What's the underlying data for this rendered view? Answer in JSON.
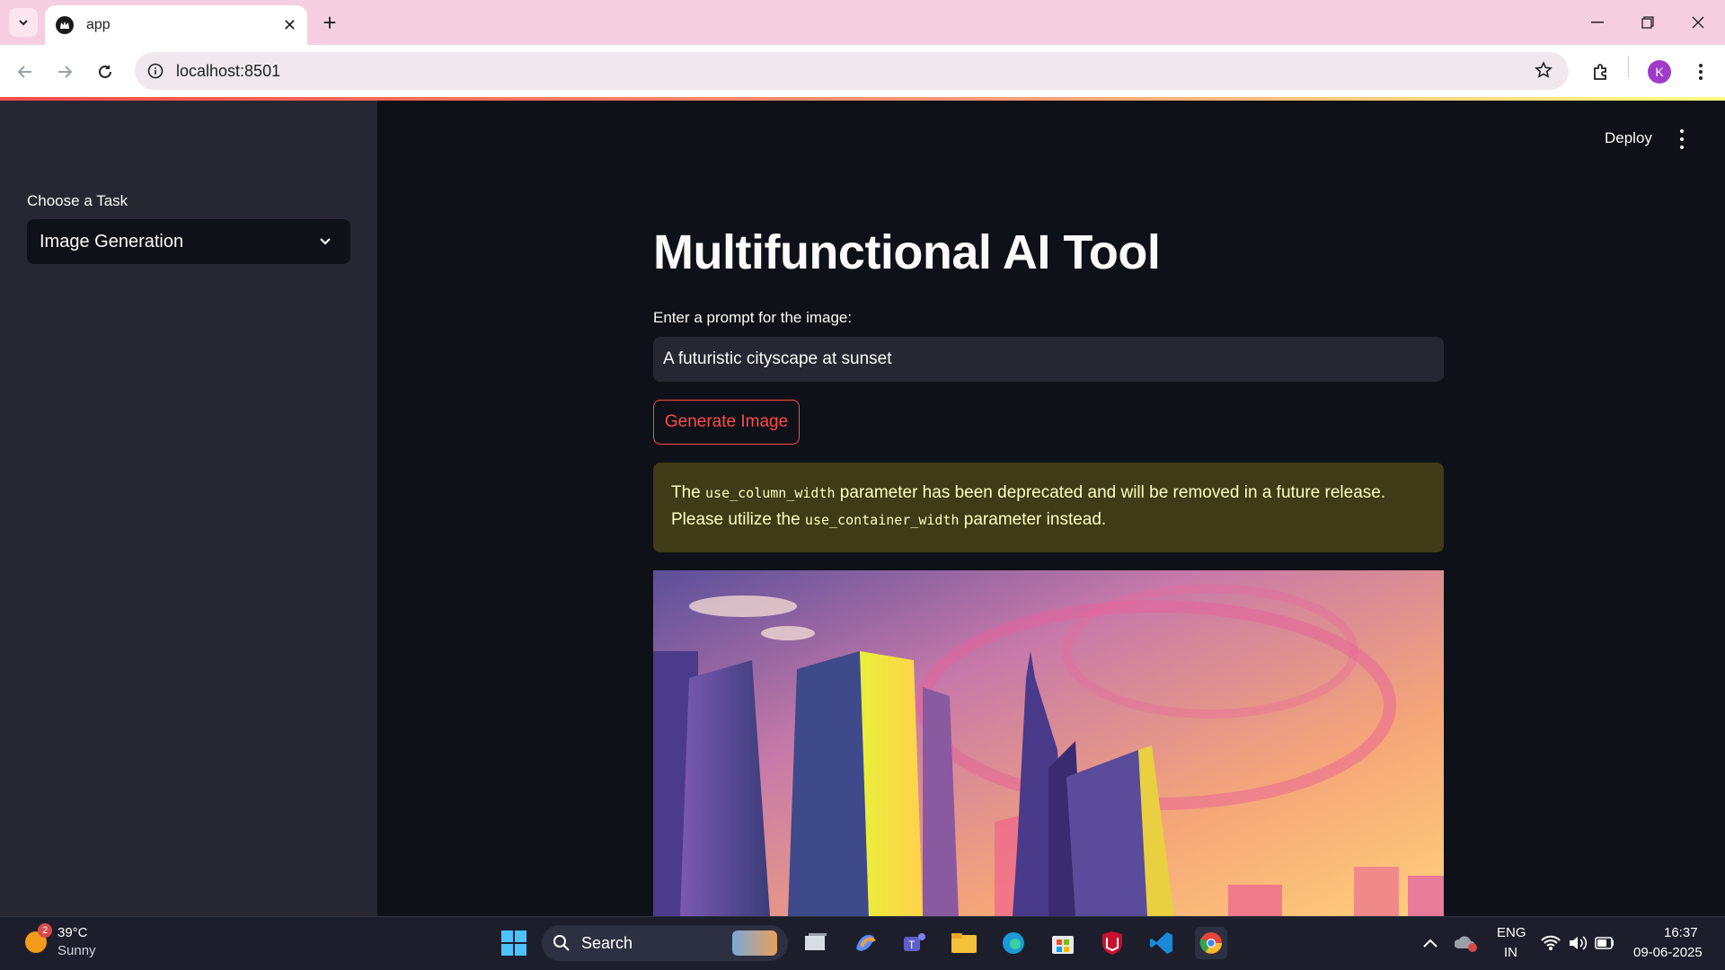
{
  "browser": {
    "tab_title": "app",
    "url": "localhost:8501",
    "profile_initial": "K"
  },
  "sidebar": {
    "task_label": "Choose a Task",
    "task_selected": "Image Generation"
  },
  "header": {
    "deploy_label": "Deploy"
  },
  "main": {
    "title": "Multifunctional AI Tool",
    "prompt_label": "Enter a prompt for the image:",
    "prompt_value": "A futuristic cityscape at sunset",
    "generate_button": "Generate Image",
    "warning": {
      "part1": "The ",
      "code1": "use_column_width",
      "part2": " parameter has been deprecated and will be removed in a future release. Please utilize the ",
      "code2": "use_container_width",
      "part3": " parameter instead."
    }
  },
  "taskbar": {
    "weather_temp": "39°C",
    "weather_desc": "Sunny",
    "weather_badge": "2",
    "search_label": "Search",
    "lang_top": "ENG",
    "lang_bottom": "IN",
    "time": "16:37",
    "date": "09-06-2025"
  },
  "colors": {
    "primary": "#ff4b4b",
    "sidebar_bg": "#262730",
    "app_bg": "#0e1117",
    "warning_bg": "#3e3b16",
    "warning_text": "#ffffc2"
  }
}
